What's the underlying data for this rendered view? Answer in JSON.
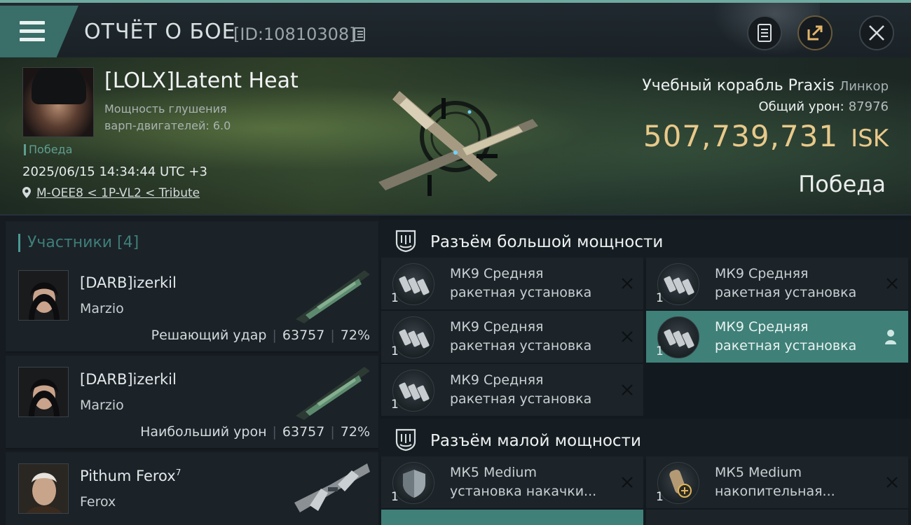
{
  "header": {
    "title": "ОТЧЁТ О БОЕ",
    "report_id": "[ID:10810308]",
    "icons": [
      "menu-icon",
      "copy-icon",
      "report-icon",
      "share-icon",
      "close-icon"
    ]
  },
  "victim": {
    "pilot_name": "[LOLX]Latent Heat",
    "warp_disruption_line1": "Мощность глушения",
    "warp_disruption_line2": "варп-двигателей: 6.0",
    "status_small": "Победа",
    "datetime": "2025/06/15 14:34:44 UTC +3",
    "location": "M-OEE8 < 1P-VL2 < Tribute",
    "ship_name": "Учебный корабль Praxis",
    "ship_class": "Линкор",
    "total_damage_label": "Общий урон:",
    "total_damage_value": "87976",
    "isk_amount": "507,739,731",
    "isk_currency": "ISK",
    "status_big": "Победа"
  },
  "participants": {
    "title": "Участники [4]",
    "rows": [
      {
        "name": "[DARB]izerkil",
        "ship": "Marzio",
        "role": "Решающий удар",
        "damage": "63757",
        "percent": "72%"
      },
      {
        "name": "[DARB]izerkil",
        "ship": "Marzio",
        "role": "Наибольший урон",
        "damage": "63757",
        "percent": "72%"
      },
      {
        "name": "Pithum Ferox",
        "name_sup": "7",
        "ship": "Ferox",
        "role": "",
        "damage": "",
        "percent": ""
      }
    ]
  },
  "high_slots": {
    "title": "Разъём большой мощности",
    "modules": [
      {
        "line1": "МК9 Средняя",
        "line2": "ракетная установка",
        "qty": "1",
        "state": "destroyed"
      },
      {
        "line1": "МК9 Средняя",
        "line2": "ракетная установка",
        "qty": "1",
        "state": "destroyed"
      },
      {
        "line1": "МК9 Средняя",
        "line2": "ракетная установка",
        "qty": "1",
        "state": "destroyed"
      },
      {
        "line1": "МК9 Средняя",
        "line2": "ракетная установка",
        "qty": "1",
        "state": "dropped"
      },
      {
        "line1": "МК9 Средняя",
        "line2": "ракетная установка",
        "qty": "1",
        "state": "destroyed"
      }
    ]
  },
  "low_slots": {
    "title": "Разъём малой мощности",
    "modules": [
      {
        "line1": "МК5 Medium",
        "line2": "установка накачки...",
        "qty": "1",
        "state": "destroyed"
      },
      {
        "line1": "МК5 Medium",
        "line2": "накопительная...",
        "qty": "1",
        "state": "destroyed"
      }
    ]
  },
  "colors": {
    "accent_teal": "#3f8078",
    "isk_gold": "#e8c98a",
    "background": "#0f1418"
  }
}
